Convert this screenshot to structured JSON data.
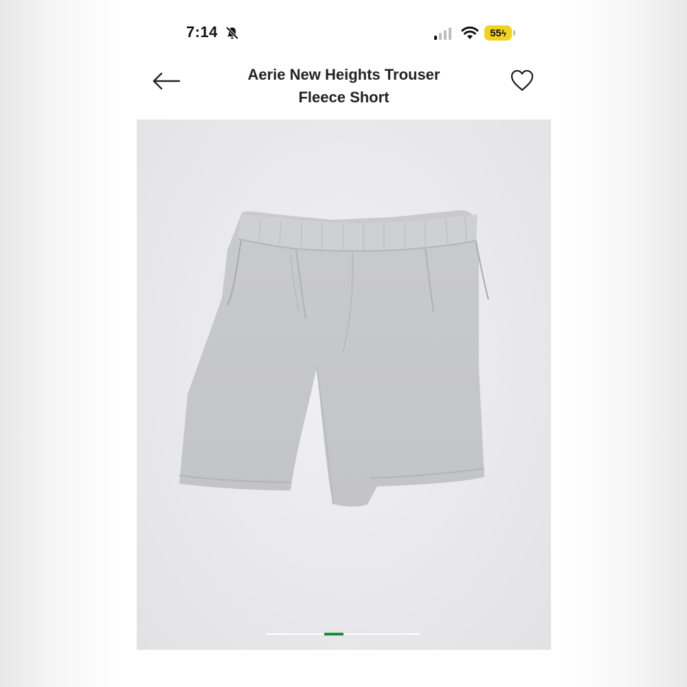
{
  "status_bar": {
    "time": "7:14",
    "battery_level": "55",
    "icons": [
      "bell-slash-icon",
      "signal-icon",
      "wifi-icon",
      "battery-charging-icon"
    ]
  },
  "header": {
    "title_line1": "Aerie New Heights Trouser",
    "title_line2": "Fleece Short",
    "back_icon": "arrow-left-icon",
    "favorite_icon": "heart-icon"
  },
  "gallery": {
    "image_alt": "Aerie New Heights Trouser Fleece Short",
    "slide_count": 8,
    "active_index": 3,
    "accent_color": "#1e8a3c"
  },
  "colors": {
    "background": "#ffffff",
    "text": "#222222",
    "battery": "#f2d21b"
  }
}
